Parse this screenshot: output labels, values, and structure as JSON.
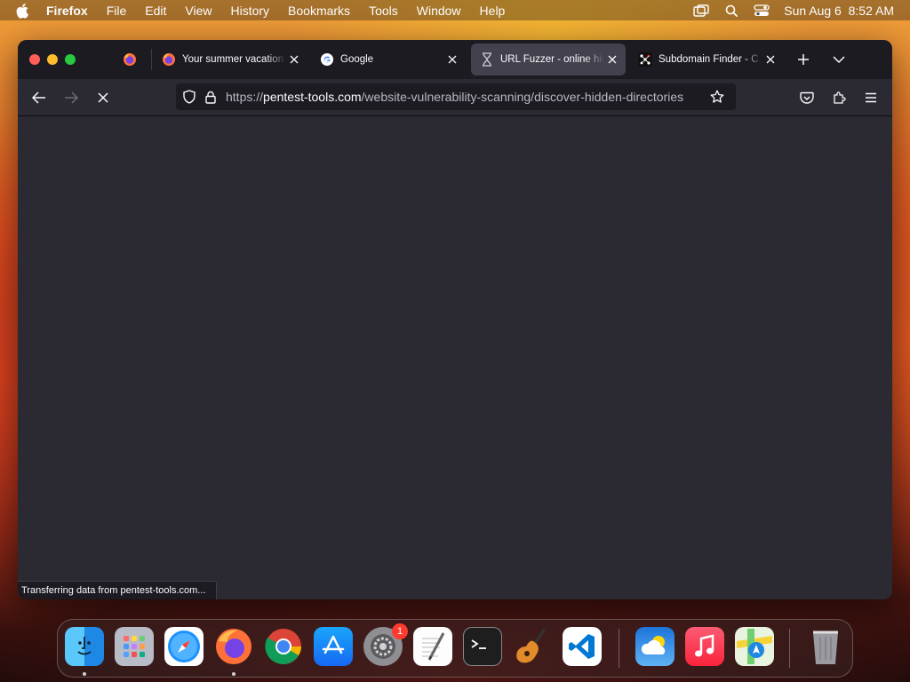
{
  "menubar": {
    "app": "Firefox",
    "items": [
      "File",
      "Edit",
      "View",
      "History",
      "Bookmarks",
      "Tools",
      "Window",
      "Help"
    ],
    "datetime": "Sun Aug 6  8:52 AM"
  },
  "tabs": [
    {
      "title": "Your summer vacation",
      "favicon": "firefox-icon",
      "active": false
    },
    {
      "title": "Google",
      "favicon": "google-icon",
      "active": false
    },
    {
      "title": "URL Fuzzer - online hid",
      "favicon": "hourglass-icon",
      "active": true
    },
    {
      "title": "Subdomain Finder - C",
      "favicon": "pentest-tools-icon",
      "active": false
    }
  ],
  "url": {
    "scheme": "https://",
    "host": "pentest-tools.com",
    "path": "/website-vulnerability-scanning/discover-hidden-directories"
  },
  "status": "Transferring data from pentest-tools.com...",
  "dock": {
    "apps": [
      "Finder",
      "Launchpad",
      "Safari",
      "Firefox",
      "Google Chrome",
      "App Store",
      "System Settings",
      "TextEdit",
      "Terminal",
      "GarageBand",
      "Visual Studio Code",
      "Weather",
      "Music",
      "Maps",
      "Trash"
    ],
    "settings_badge": "1"
  }
}
